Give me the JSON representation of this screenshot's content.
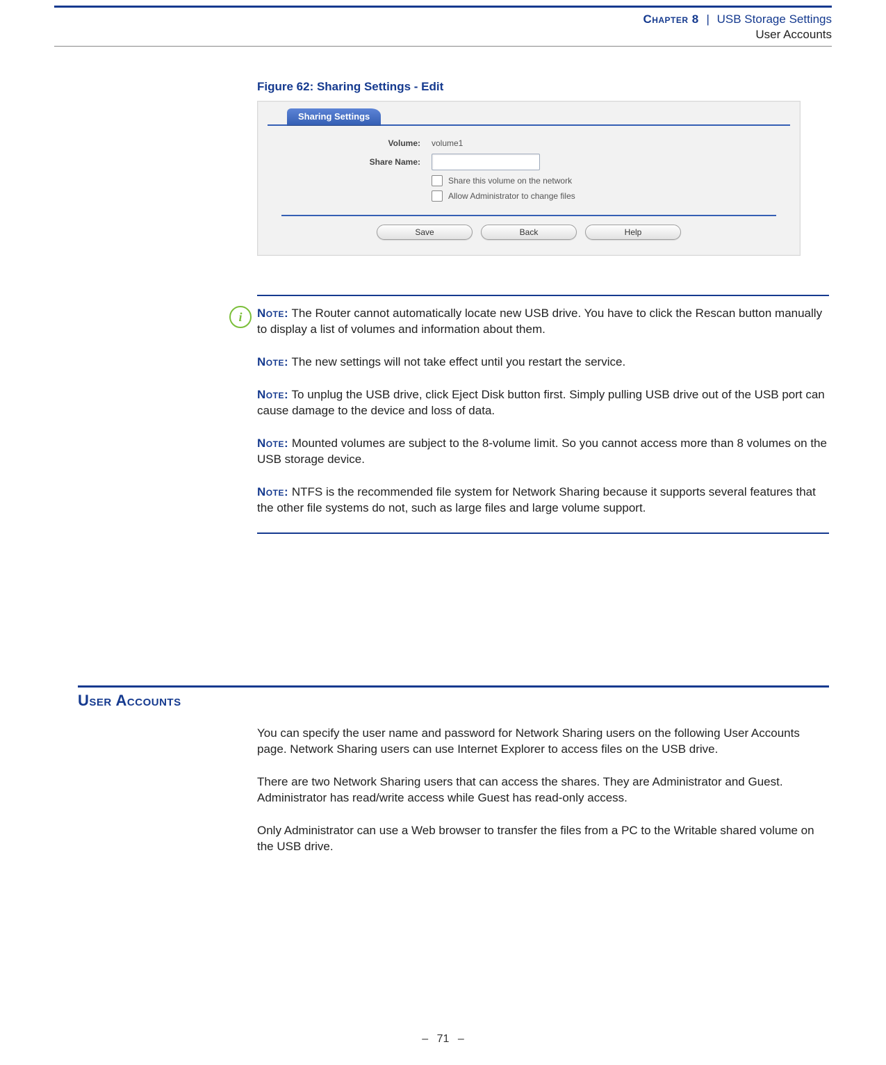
{
  "header": {
    "chapter_label": "Chapter 8",
    "separator": "|",
    "chapter_title": "USB Storage Settings",
    "sub_title": "User Accounts"
  },
  "figure": {
    "caption": "Figure 62:  Sharing Settings - Edit"
  },
  "screenshot": {
    "tab_label": "Sharing Settings",
    "volume_label": "Volume:",
    "volume_value": "volume1",
    "share_name_label": "Share Name:",
    "share_name_value": "",
    "share_name_placeholder": "",
    "cb_share_label": "Share this volume on the network",
    "cb_admin_label": "Allow Administrator to change files",
    "buttons": {
      "save": "Save",
      "back": "Back",
      "help": "Help"
    }
  },
  "notes": {
    "icon_glyph": "i",
    "label": "Note:",
    "n1": "The Router cannot automatically locate new USB drive. You have to click the Rescan button manually to display a list of volumes and information about them.",
    "n2": "The new settings will not take effect until you restart the service.",
    "n3": "To unplug the USB drive, click Eject Disk button first. Simply pulling USB drive out of the USB port can cause damage to the device and loss of data.",
    "n4": "Mounted volumes are subject to the 8-volume limit. So you cannot access more than 8 volumes on the USB storage device.",
    "n5": "NTFS is the recommended file system for Network Sharing because it supports several features that the other file systems do not, such as large files and large volume support."
  },
  "section": {
    "heading": "User Accounts",
    "p1": "You can specify the user name and password for Network Sharing users on the following User Accounts page. Network Sharing users can use Internet Explorer to access files on the USB drive.",
    "p2": "There are two Network Sharing users that can access the shares. They are Administrator and Guest. Administrator has read/write access while Guest has read-only access.",
    "p3": "Only Administrator can use a Web browser to transfer the files from a PC to the Writable shared volume on the USB drive."
  },
  "footer": {
    "page_number": "71"
  }
}
